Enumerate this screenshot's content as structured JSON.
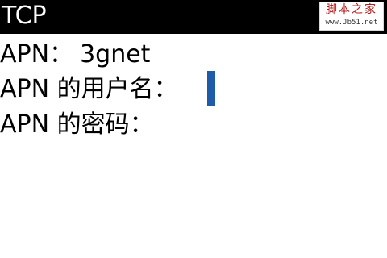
{
  "window": {
    "title": "TCP"
  },
  "watermark": {
    "line1": "脚本之家",
    "line2": "www.Jb51.net"
  },
  "form": {
    "apn_label": "APN：",
    "apn_value": "3gnet",
    "username_label": "APN 的用户名：",
    "username_value": "",
    "password_label": "APN 的密码：",
    "password_value": ""
  },
  "colors": {
    "titlebar_bg": "#000000",
    "cursor": "#1e5ba8",
    "watermark_text": "#b81c1c"
  }
}
